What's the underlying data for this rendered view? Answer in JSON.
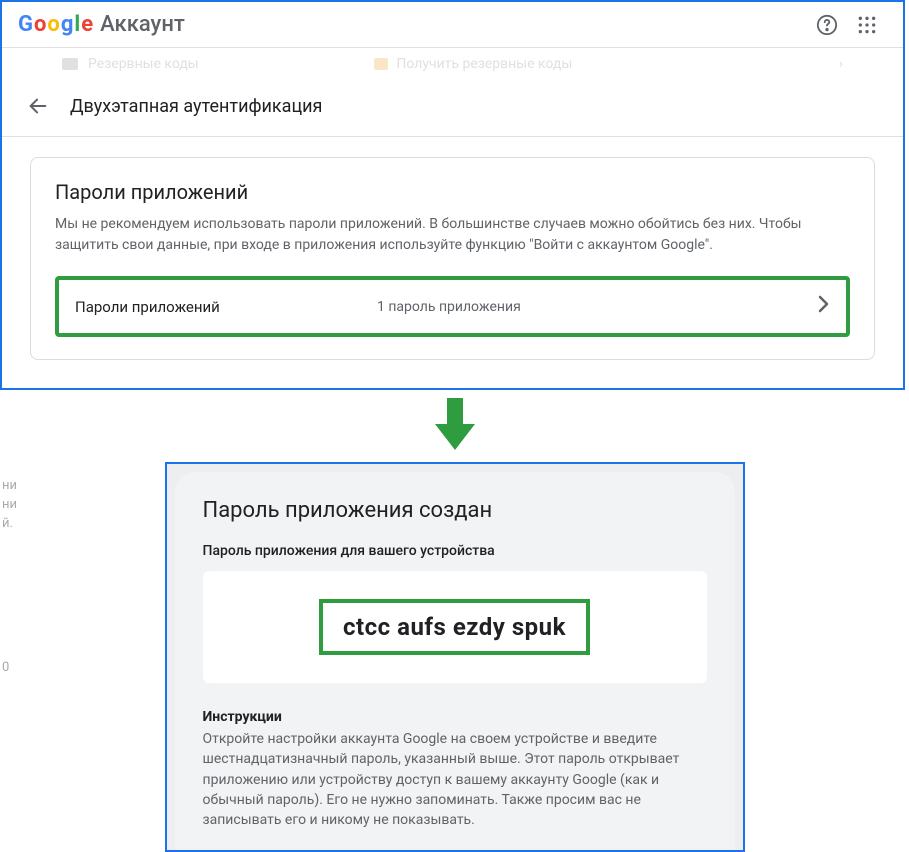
{
  "header": {
    "logo_account": "Аккаунт"
  },
  "faded": {
    "left": "Резервные коды",
    "mid": "Получить резервные коды"
  },
  "subheader": {
    "title": "Двухэтапная аутентификация"
  },
  "card": {
    "title": "Пароли приложений",
    "desc": "Мы не рекомендуем использовать пароли приложений. В большинстве случаев можно обойтись без них. Чтобы защитить свои данные, при входе в приложения используйте функцию \"Войти с аккаунтом Google\".",
    "row_label": "Пароли приложений",
    "row_value": "1 пароль приложения"
  },
  "dialog": {
    "title": "Пароль приложения создан",
    "pwd_label": "Пароль приложения для вашего устройства",
    "password": "ctcc aufs ezdy spuk",
    "instr_title": "Инструкции",
    "instr_text": "Откройте настройки аккаунта Google на своем устройстве и введите шестнадцатизначный пароль, указанный выше.\nЭтот пароль открывает приложению или устройству доступ к вашему аккаунту Google (как и обычный пароль). Его не нужно запоминать. Также просим вас не записывать его и никому не показывать."
  }
}
